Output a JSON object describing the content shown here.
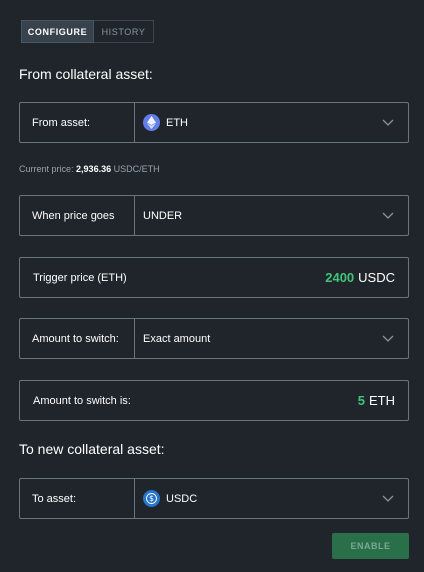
{
  "tabs": [
    {
      "label": "CONFIGURE",
      "active": true
    },
    {
      "label": "HISTORY",
      "active": false
    }
  ],
  "from_section": {
    "title": "From collateral asset:"
  },
  "from_asset": {
    "label": "From asset:",
    "value": "ETH",
    "icon": "eth-icon"
  },
  "current_price": {
    "label": "Current price:",
    "value": "2,936.36",
    "unit": "USDC/ETH"
  },
  "price_condition": {
    "label": "When price goes",
    "value": "UNDER"
  },
  "trigger_price": {
    "label": "Trigger price (ETH)",
    "amount": "2400",
    "unit": "USDC"
  },
  "amount_mode": {
    "label": "Amount to switch:",
    "value": "Exact amount"
  },
  "amount_value": {
    "label": "Amount to switch is:",
    "amount": "5",
    "unit": "ETH"
  },
  "to_section": {
    "title": "To new collateral asset:"
  },
  "to_asset": {
    "label": "To asset:",
    "value": "USDC",
    "icon": "usdc-icon"
  },
  "enable_button": {
    "label": "ENABLE"
  },
  "colors": {
    "background": "#1f252b",
    "accent_green": "#3fc47a",
    "button_green": "#2d8a55",
    "border": "#6a7480"
  }
}
